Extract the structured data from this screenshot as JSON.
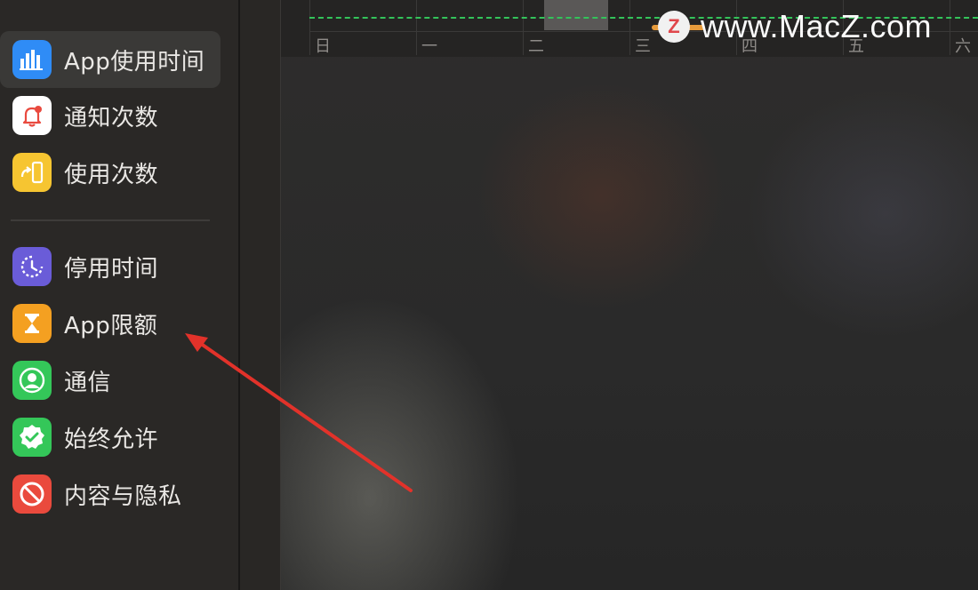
{
  "sidebar": {
    "items": [
      {
        "label": "App使用时间",
        "icon": "bar-chart-icon",
        "color": "#2f8cf6",
        "selected": true
      },
      {
        "label": "通知次数",
        "icon": "bell-icon",
        "color": "#ffffff",
        "selected": false
      },
      {
        "label": "使用次数",
        "icon": "phone-pickup-icon",
        "color": "#f6c531",
        "selected": false
      },
      {
        "label": "停用时间",
        "icon": "downtime-icon",
        "color": "#6a5cd8",
        "selected": false
      },
      {
        "label": "App限额",
        "icon": "hourglass-icon",
        "color": "#f4a021",
        "selected": false
      },
      {
        "label": "通信",
        "icon": "person-icon",
        "color": "#34c759",
        "selected": false
      },
      {
        "label": "始终允许",
        "icon": "checkmark-badge-icon",
        "color": "#34c759",
        "selected": false
      },
      {
        "label": "内容与隐私",
        "icon": "restriction-icon",
        "color": "#ea4a3d",
        "selected": false
      }
    ]
  },
  "chart": {
    "days": [
      "日",
      "一",
      "二",
      "三",
      "四",
      "五",
      "六"
    ]
  },
  "watermark": {
    "badge": "Z",
    "text": "www.MacZ.com"
  },
  "colors": {
    "accent_green_dash": "#33c35a",
    "annotation_arrow": "#e2322a"
  }
}
